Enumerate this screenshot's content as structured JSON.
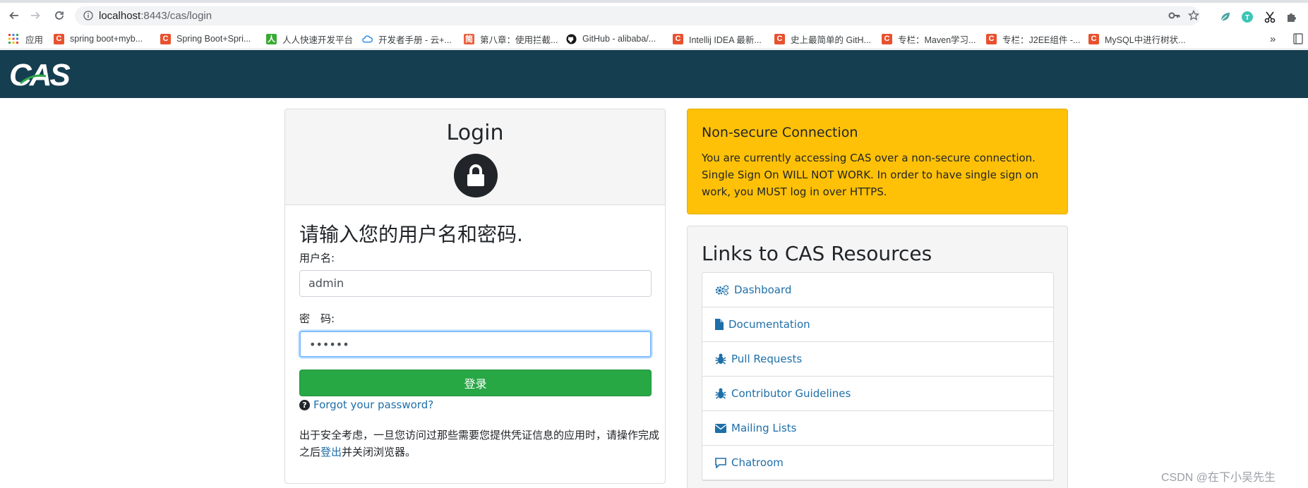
{
  "browser": {
    "url_host": "localhost",
    "url_rest": ":8443/cas/login",
    "apps_label": "应用",
    "bookmarks": [
      {
        "label": "spring boot+myb...",
        "icon": "csdn-icon"
      },
      {
        "label": "Spring Boot+Spri...",
        "icon": "csdn-icon"
      },
      {
        "label": "人人快速开发平台",
        "icon": "renren-icon"
      },
      {
        "label": "开发者手册 - 云+...",
        "icon": "cloud-icon"
      },
      {
        "label": "第八章：使用拦截...",
        "icon": "jianshu-icon"
      },
      {
        "label": "GitHub - alibaba/...",
        "icon": "github-icon"
      },
      {
        "label": "Intellij IDEA 最新...",
        "icon": "csdn-icon"
      },
      {
        "label": "史上最简单的 GitH...",
        "icon": "csdn-icon"
      },
      {
        "label": "专栏：Maven学习...",
        "icon": "csdn-icon"
      },
      {
        "label": "专栏：J2EE组件 -...",
        "icon": "csdn-icon"
      },
      {
        "label": "MySQL中进行树状...",
        "icon": "csdn-icon"
      }
    ],
    "overflow": "»"
  },
  "header": {
    "logo_text": "CAS"
  },
  "login": {
    "title": "Login",
    "prompt": "请输入您的用户名和密码.",
    "username_label": "用户名:",
    "username_value": "admin",
    "password_label": "密　码:",
    "password_value": "••••••",
    "submit_label": "登录",
    "forgot_label": "Forgot your password?",
    "notice_before": "出于安全考虑，一旦您访问过那些需要您提供凭证信息的应用时，请操作完成之后",
    "notice_link": "登出",
    "notice_after": "并关闭浏览器。"
  },
  "warning": {
    "title": "Non-secure Connection",
    "body": "You are currently accessing CAS over a non-secure connection. Single Sign On WILL NOT WORK. In order to have single sign on work, you MUST log in over HTTPS."
  },
  "resources": {
    "title": "Links to CAS Resources",
    "items": [
      {
        "label": "Dashboard",
        "icon": "gears-icon"
      },
      {
        "label": "Documentation",
        "icon": "file-icon"
      },
      {
        "label": "Pull Requests",
        "icon": "bug-icon"
      },
      {
        "label": "Contributor Guidelines",
        "icon": "bug-icon"
      },
      {
        "label": "Mailing Lists",
        "icon": "envelope-icon"
      },
      {
        "label": "Chatroom",
        "icon": "comment-icon"
      }
    ]
  },
  "watermark": "CSDN @在下小吴先生",
  "colors": {
    "header_bg": "#153e50",
    "warning_bg": "#ffc107",
    "submit_bg": "#28a745",
    "link": "#1e6fa8"
  }
}
